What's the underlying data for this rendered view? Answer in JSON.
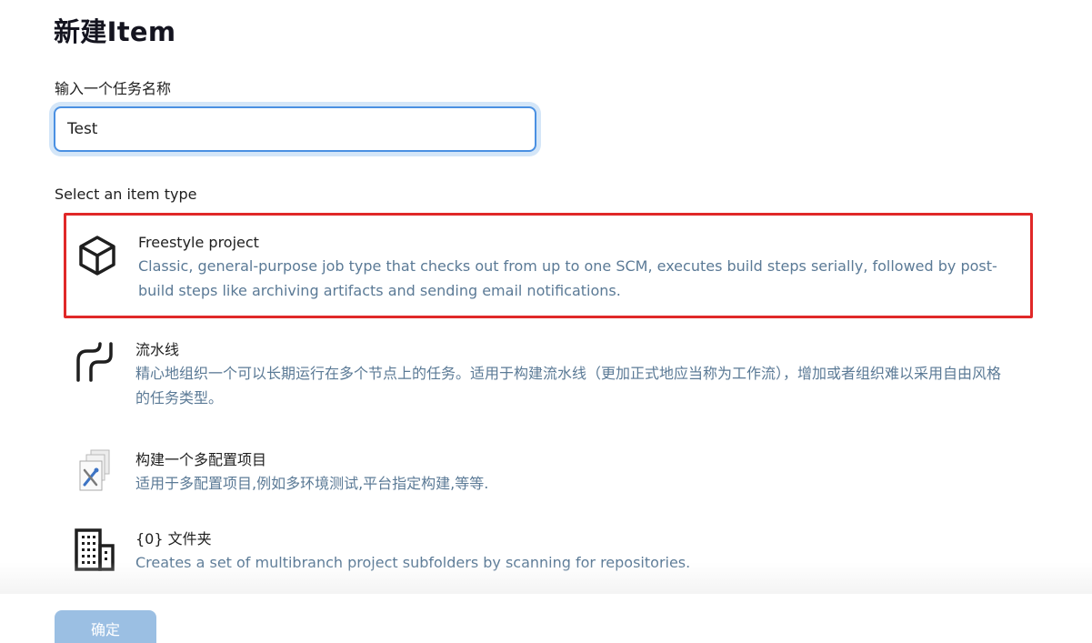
{
  "header": {
    "title": "新建Item"
  },
  "name_field": {
    "label": "输入一个任务名称",
    "value": "Test"
  },
  "item_types": {
    "label": "Select an item type",
    "items": [
      {
        "name": "Freestyle project",
        "description": "Classic, general-purpose job type that checks out from up to one SCM, executes build steps serially, followed by post-build steps like archiving artifacts and sending email notifications.",
        "icon": "cube-icon",
        "selected": true
      },
      {
        "name": "流水线",
        "description": "精心地组织一个可以长期运行在多个节点上的任务。适用于构建流水线（更加正式地应当称为工作流），增加或者组织难以采用自由风格的任务类型。",
        "icon": "pipeline-icon",
        "selected": false
      },
      {
        "name": "构建一个多配置项目",
        "description": "适用于多配置项目,例如多环境测试,平台指定构建,等等.",
        "icon": "multi-config-icon",
        "selected": false
      },
      {
        "name": "{0} 文件夹",
        "description": "Creates a set of multibranch project subfolders by scanning for repositories.",
        "icon": "building-icon",
        "selected": false
      }
    ]
  },
  "footer": {
    "ok_label": "确定"
  },
  "colors": {
    "selection_border": "#e02828",
    "description_text": "#5b7a96",
    "input_focus": "#4a90e2",
    "button_bg": "#9bbfe3"
  }
}
